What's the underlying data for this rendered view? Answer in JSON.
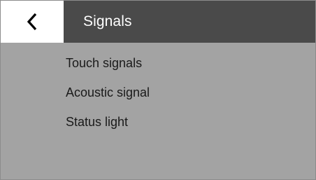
{
  "header": {
    "back_icon": "chevron-left-icon",
    "title": "Signals"
  },
  "menu": {
    "items": [
      {
        "label": "Touch signals"
      },
      {
        "label": "Acoustic signal"
      },
      {
        "label": "Status light"
      }
    ]
  },
  "colors": {
    "header_background": "#4a4a4a",
    "back_button_background": "#ffffff",
    "panel_background": "#a3a3a3",
    "text_dark": "#1a1a1a",
    "text_light": "#ffffff"
  }
}
